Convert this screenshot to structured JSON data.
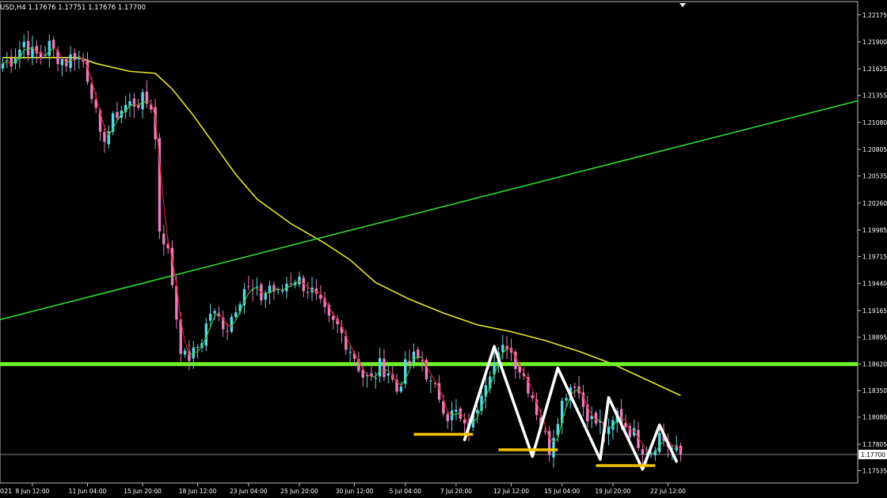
{
  "header": {
    "symbol_text": "USD,H4  1.17676  1.17751  1.17676  1.17700",
    "year_stub": "021"
  },
  "chart_data": {
    "type": "candlestick",
    "colors": {
      "background": "#000000",
      "frame": "#c0c0c0",
      "bull": "#5bd6e4",
      "bear": "#e67fc0",
      "ma_slow": "#e9e62a",
      "ma_fast_up": "#2ecc40",
      "ma_fast_down": "#e02020",
      "trendline": "#2fdc2f",
      "support": "#6ef02a",
      "zigzag": "#ffffff",
      "lows_marker": "#f5c400",
      "price_box": "#ffffff"
    },
    "ylim": [
      1.1741,
      1.2231
    ],
    "y_ticks": [
      "1.22175",
      "1.21900",
      "1.21625",
      "1.21355",
      "1.21080",
      "1.20805",
      "1.20535",
      "1.20260",
      "1.19985",
      "1.19715",
      "1.19440",
      "1.19165",
      "1.18895",
      "1.18620",
      "1.18350",
      "1.18080",
      "1.17805",
      "1.17535"
    ],
    "current_price": "1.17700",
    "x_ticks": [
      {
        "i": 7,
        "label": "8 Jun 12:00"
      },
      {
        "i": 20,
        "label": "11 Jun 04:00"
      },
      {
        "i": 33,
        "label": "15 Jun 20:00"
      },
      {
        "i": 46,
        "label": "18 Jun 12:00"
      },
      {
        "i": 58,
        "label": "23 Jun 04:00"
      },
      {
        "i": 70,
        "label": "25 Jun 20:00"
      },
      {
        "i": 83,
        "label": "30 Jun 12:00"
      },
      {
        "i": 95,
        "label": "5 Jul 04:00"
      },
      {
        "i": 107,
        "label": "7 Jul 20:00"
      },
      {
        "i": 120,
        "label": "12 Jul 12:00"
      },
      {
        "i": 132,
        "label": "15 Jul 04:00"
      },
      {
        "i": 144,
        "label": "19 Jul 20:00"
      },
      {
        "i": 157,
        "label": "22 Jul 12:00"
      }
    ],
    "candle_count": 161,
    "close_anchors": [
      [
        0,
        1.2168
      ],
      [
        2,
        1.2172
      ],
      [
        4,
        1.2183
      ],
      [
        5,
        1.219
      ],
      [
        7,
        1.2178
      ],
      [
        9,
        1.2175
      ],
      [
        11,
        1.2186
      ],
      [
        13,
        1.2175
      ],
      [
        15,
        1.217
      ],
      [
        17,
        1.2178
      ],
      [
        19,
        1.217
      ],
      [
        21,
        1.214
      ],
      [
        22,
        1.2115
      ],
      [
        23,
        1.209
      ],
      [
        25,
        1.21
      ],
      [
        27,
        1.2118
      ],
      [
        29,
        1.2125
      ],
      [
        31,
        1.2128
      ],
      [
        33,
        1.213
      ],
      [
        35,
        1.2126
      ],
      [
        36,
        1.209
      ],
      [
        37,
        1.2
      ],
      [
        38,
        1.199
      ],
      [
        39,
        1.1975
      ],
      [
        40,
        1.1945
      ],
      [
        41,
        1.191
      ],
      [
        42,
        1.188
      ],
      [
        43,
        1.1868
      ],
      [
        45,
        1.1872
      ],
      [
        47,
        1.1888
      ],
      [
        49,
        1.1915
      ],
      [
        51,
        1.1908
      ],
      [
        53,
        1.19
      ],
      [
        55,
        1.1922
      ],
      [
        57,
        1.194
      ],
      [
        59,
        1.1935
      ],
      [
        61,
        1.193
      ],
      [
        63,
        1.1942
      ],
      [
        65,
        1.1932
      ],
      [
        67,
        1.1945
      ],
      [
        69,
        1.195
      ],
      [
        71,
        1.1943
      ],
      [
        73,
        1.1935
      ],
      [
        75,
        1.192
      ],
      [
        77,
        1.1905
      ],
      [
        79,
        1.19
      ],
      [
        81,
        1.1885
      ],
      [
        83,
        1.187
      ],
      [
        85,
        1.185
      ],
      [
        87,
        1.1845
      ],
      [
        89,
        1.186
      ],
      [
        91,
        1.1855
      ],
      [
        93,
        1.1835
      ],
      [
        95,
        1.1858
      ],
      [
        97,
        1.1868
      ],
      [
        99,
        1.1866
      ],
      [
        101,
        1.184
      ],
      [
        103,
        1.183
      ],
      [
        105,
        1.181
      ],
      [
        107,
        1.1812
      ],
      [
        109,
        1.1795
      ],
      [
        111,
        1.1805
      ],
      [
        113,
        1.1838
      ],
      [
        115,
        1.1858
      ],
      [
        117,
        1.1868
      ],
      [
        119,
        1.1883
      ],
      [
        121,
        1.1865
      ],
      [
        123,
        1.185
      ],
      [
        125,
        1.183
      ],
      [
        127,
        1.18
      ],
      [
        129,
        1.1776
      ],
      [
        131,
        1.181
      ],
      [
        133,
        1.1835
      ],
      [
        135,
        1.1845
      ],
      [
        137,
        1.182
      ],
      [
        139,
        1.1805
      ],
      [
        141,
        1.18
      ],
      [
        143,
        1.179
      ],
      [
        145,
        1.1812
      ],
      [
        147,
        1.18
      ],
      [
        149,
        1.179
      ],
      [
        151,
        1.1778
      ],
      [
        153,
        1.1775
      ],
      [
        155,
        1.179
      ],
      [
        157,
        1.178
      ],
      [
        159,
        1.1772
      ],
      [
        160,
        1.177
      ]
    ],
    "ma_slow": [
      [
        0,
        1.2174
      ],
      [
        18,
        1.2174
      ],
      [
        22,
        1.2168
      ],
      [
        30,
        1.216
      ],
      [
        36,
        1.2158
      ],
      [
        40,
        1.2142
      ],
      [
        45,
        1.2115
      ],
      [
        50,
        1.2085
      ],
      [
        55,
        1.2055
      ],
      [
        60,
        1.203
      ],
      [
        68,
        1.2005
      ],
      [
        76,
        1.1985
      ],
      [
        82,
        1.1968
      ],
      [
        88,
        1.1945
      ],
      [
        96,
        1.1928
      ],
      [
        104,
        1.1914
      ],
      [
        112,
        1.1902
      ],
      [
        120,
        1.1895
      ],
      [
        128,
        1.1886
      ],
      [
        136,
        1.1875
      ],
      [
        144,
        1.1862
      ],
      [
        152,
        1.1846
      ],
      [
        160,
        1.183
      ]
    ],
    "trendline": [
      [
        0,
        1.1908
      ],
      [
        160,
        1.2084
      ]
    ],
    "support_level": 1.1862,
    "zigzag": [
      [
        109,
        1.1785
      ],
      [
        116,
        1.188
      ],
      [
        125,
        1.1768
      ],
      [
        131,
        1.1858
      ],
      [
        141,
        1.1765
      ],
      [
        143,
        1.1828
      ],
      [
        151,
        1.1755
      ],
      [
        155,
        1.18
      ],
      [
        159,
        1.1763
      ]
    ],
    "lows_markers": [
      {
        "from": 97,
        "to": 111,
        "y": 1.17905
      },
      {
        "from": 117,
        "to": 131,
        "y": 1.17748
      },
      {
        "from": 140,
        "to": 154,
        "y": 1.17587
      }
    ]
  }
}
